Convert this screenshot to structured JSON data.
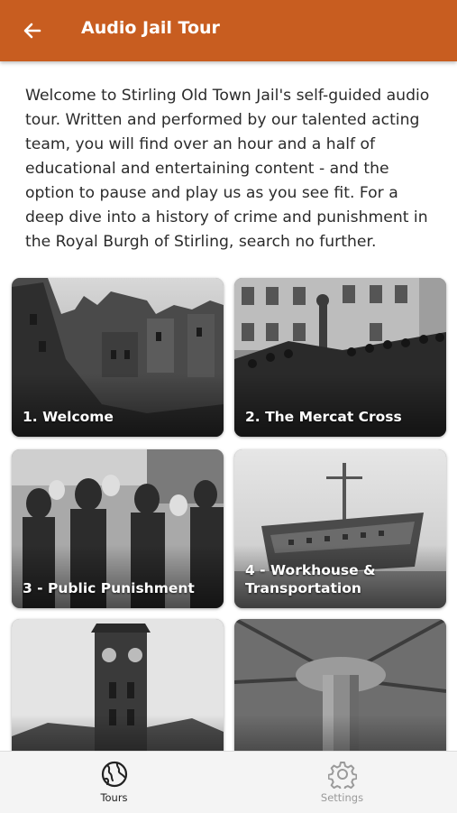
{
  "header": {
    "title": "Audio Jail Tour",
    "back_icon": "arrow-left-icon",
    "background_color": "#c85d20"
  },
  "intro": {
    "text": "Welcome to Stirling Old Town Jail's self-guided audio tour. Written and performed by our talented acting team, you will find over an hour and a half of educational and entertaining content - and the option to pause and play us as you see fit. For a deep dive into a history of crime and punishment in the Royal Burgh of Stirling, search no further."
  },
  "tours": [
    {
      "label": "1. Welcome",
      "image": "gothic castle towers photo"
    },
    {
      "label": "2. The Mercat Cross",
      "image": "crowd around market cross photo"
    },
    {
      "label": "3 - Public Punishment",
      "image": "crowd of people photo"
    },
    {
      "label": "4 - Workhouse & Transportation",
      "image": "old prison ship photo"
    },
    {
      "label": "",
      "image": "clock tower photo"
    },
    {
      "label": "",
      "image": "stone pillar and vault photo"
    }
  ],
  "tabbar": {
    "tabs": [
      {
        "label": "Tours",
        "icon": "globe-icon",
        "active": true,
        "color": "#222222"
      },
      {
        "label": "Settings",
        "icon": "gear-icon",
        "active": false,
        "color": "#9a9a9a"
      }
    ]
  }
}
